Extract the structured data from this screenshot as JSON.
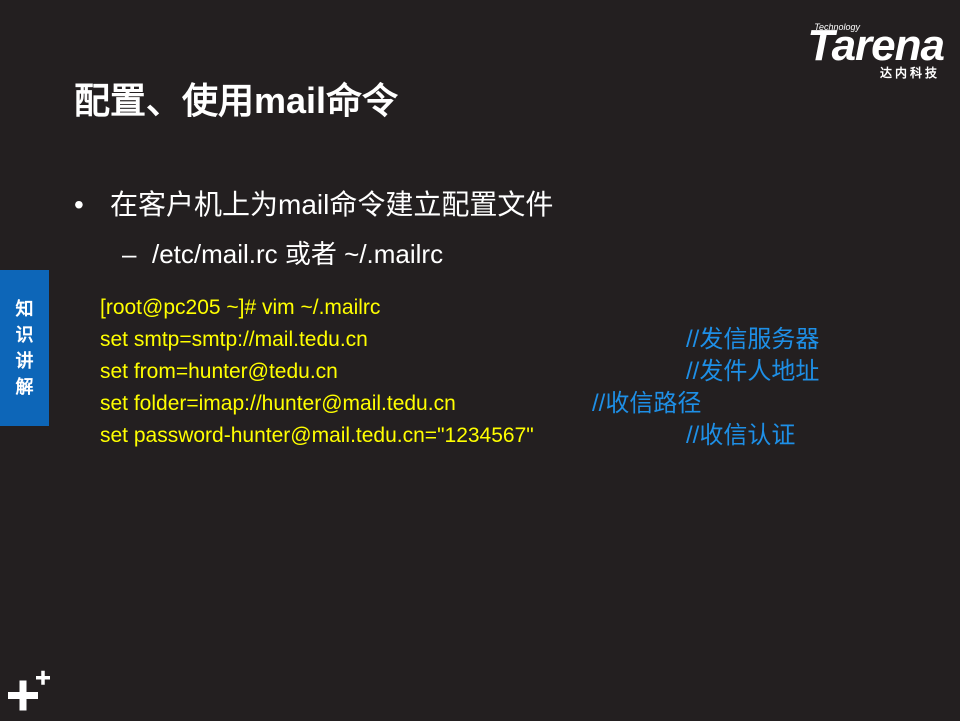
{
  "logo": {
    "technology": "Technology",
    "wordmark": "Tarena",
    "chinese": "达内科技"
  },
  "title": "配置、使用mail命令",
  "bullets": [
    {
      "marker": "•",
      "text": "在客户机上为mail命令建立配置文件"
    },
    {
      "marker": "–",
      "text": "/etc/mail.rc 或者 ~/.mailrc"
    }
  ],
  "side_tab": [
    "知",
    "识",
    "讲",
    "解"
  ],
  "code_lines": [
    {
      "code": "[root@pc205 ~]# vim  ~/.mailrc",
      "comment": ""
    },
    {
      "code": "set smtp=smtp://mail.tedu.cn",
      "comment": "//发信服务器"
    },
    {
      "code": "set from=hunter@tedu.cn",
      "comment": "//发件人地址"
    },
    {
      "code": "set folder=imap://hunter@mail.tedu.cn",
      "comment": "//收信路径"
    },
    {
      "code": "set password-hunter@mail.tedu.cn=\"1234567\"",
      "comment": "//收信认证"
    }
  ],
  "colors": {
    "background": "#231f20",
    "code": "#ffff00",
    "comment": "#1e8fe6",
    "side_tab": "#0d66b8"
  },
  "icons": {
    "corner": "plus-icon"
  }
}
